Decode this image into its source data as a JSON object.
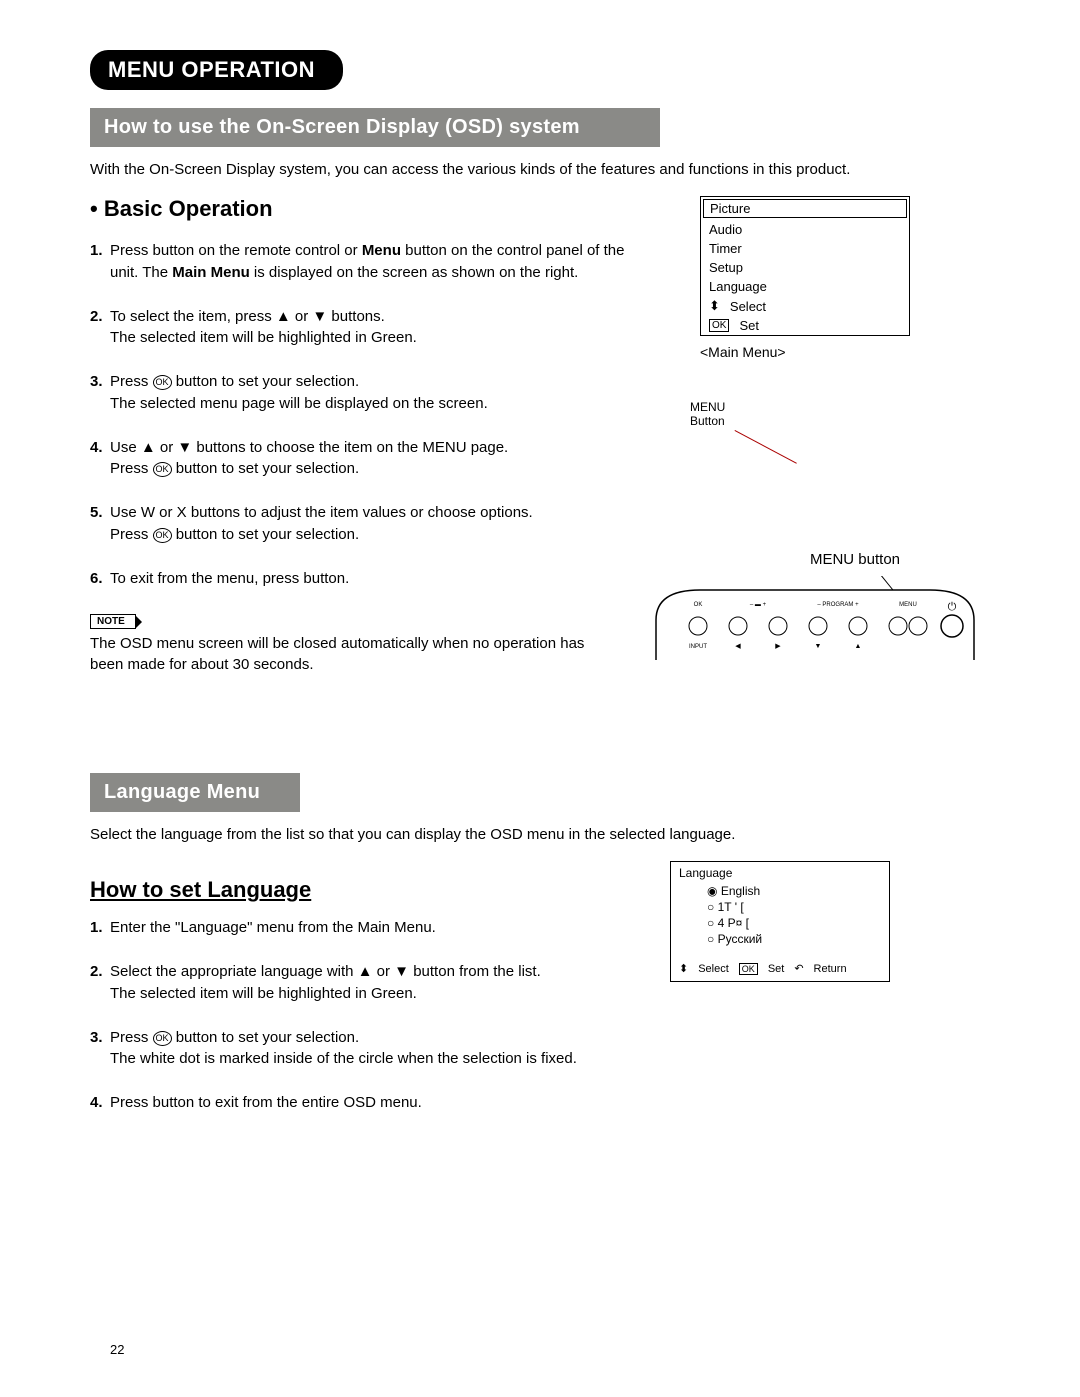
{
  "header": {
    "pill": "MENU OPERATION"
  },
  "section1": {
    "bar": "How to use the On-Screen Display (OSD) system",
    "intro": "With the On-Screen Display system, you can access the various kinds of the features and functions in this product.",
    "heading": "Basic Operation",
    "steps": [
      {
        "n": "1.",
        "html": "Press       button on the remote control or <b>Menu</b> button on the control panel of the unit. The <b>Main Menu</b> is displayed on the screen as shown on the right."
      },
      {
        "n": "2.",
        "html": "To select the item, press ▲ or ▼ buttons.<br>The selected item will be highlighted in Green."
      },
      {
        "n": "3.",
        "html": "Press  <span class='ok-circle'>OK</span>  button to set your selection.<br>The selected menu page will be displayed on the screen."
      },
      {
        "n": "4.",
        "html": "Use ▲ or ▼ buttons to choose the item on the MENU page.<br>Press  <span class='ok-circle'>OK</span>  button to set your selection."
      },
      {
        "n": "5.",
        "html": "Use  W or  X buttons to adjust the item values or choose options.<br>Press  <span class='ok-circle'>OK</span>  button to set your selection."
      },
      {
        "n": "6.",
        "html": "To exit from the menu, press       button."
      }
    ],
    "note_label": "NOTE",
    "note_text": "The OSD menu screen will be closed automatically when no operation has been made for about 30 seconds."
  },
  "main_menu_osd": {
    "items": [
      "Picture",
      "Audio",
      "Timer",
      "Setup",
      "Language"
    ],
    "select": "Select",
    "set": "Set",
    "caption": "<Main Menu>",
    "menu_label": "MENU",
    "button_label": "Button",
    "panel_caption": "MENU button"
  },
  "panel_labels": {
    "ok": "OK",
    "vol": "–  ▬  +",
    "prog": "– PROGRAM +",
    "menu": "MENU",
    "input": "INPUT"
  },
  "section2": {
    "bar": "Language Menu",
    "intro": "Select the language from the list so that you can display the OSD menu in the selected language.",
    "heading": "How to set Language",
    "steps": [
      {
        "n": "1.",
        "html": "Enter the \"Language\" menu from the Main Menu."
      },
      {
        "n": "2.",
        "html": "Select the appropriate language with ▲ or ▼ button from the list.<br>The selected item will be highlighted in Green."
      },
      {
        "n": "3.",
        "html": "Press  <span class='ok-circle'>OK</span>  button to set your selection.<br>The white dot is marked inside of the circle when the selection is fixed."
      },
      {
        "n": "4.",
        "html": "Press       button to exit from the entire OSD menu."
      }
    ]
  },
  "lang_osd": {
    "title": "Language",
    "options": [
      "English",
      "1T '  [",
      "4 P¤  [",
      "Русский"
    ],
    "select": "Select",
    "set": "Set",
    "return": "Return"
  },
  "page": "22"
}
